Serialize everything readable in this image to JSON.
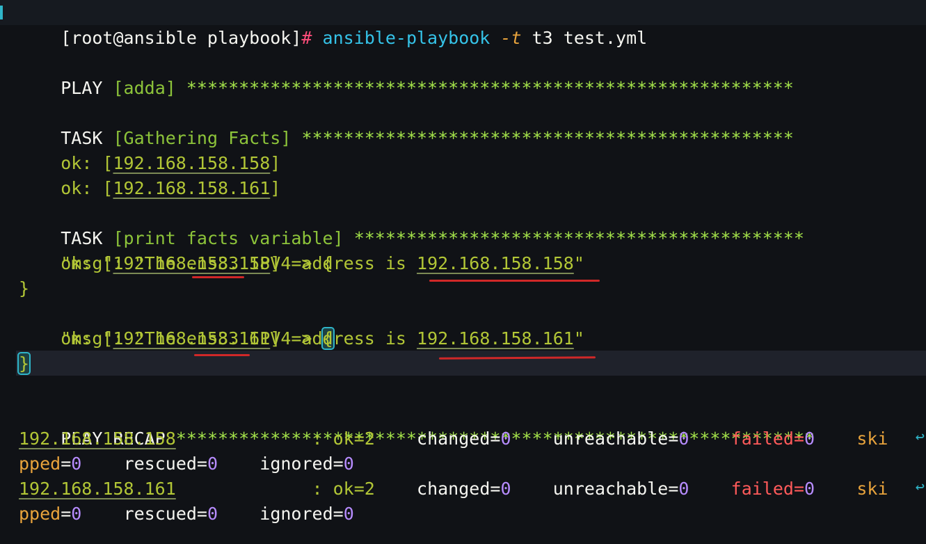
{
  "colors": {
    "background": "#101216",
    "prompt_hash": "#ff4d7a",
    "command": "#35c3e8",
    "option": "#e8a33c",
    "ok": "#b2c636",
    "stars": "#a4e34a",
    "number": "#b78cff",
    "failed": "#ff5a5a",
    "annotation": "#d02828"
  },
  "command": {
    "prompt": "[root@ansible playbook]",
    "hash": "#",
    "program": "ansible-playbook",
    "option": "-t",
    "tag": "t3",
    "file": "test.yml"
  },
  "play": {
    "label": "PLAY",
    "name": "[adda]",
    "stars": "**********************************************************"
  },
  "tasks": [
    {
      "label": "TASK",
      "name": "[Gathering Facts]",
      "stars": "***********************************************",
      "results": [
        {
          "status": "ok:",
          "host": "192.168.158.158"
        },
        {
          "status": "ok:",
          "host": "192.168.158.161"
        }
      ]
    },
    {
      "label": "TASK",
      "name": "[print facts variable]",
      "stars": "*******************************************",
      "results": [
        {
          "status": "ok:",
          "host": "192.168.158.158",
          "msg_key": "\"msg\"",
          "msg_pre": "The",
          "iface": "ens33",
          "msg_mid": "IPV4 address is",
          "address": "192.168.158.158"
        },
        {
          "status": "ok:",
          "host": "192.168.158.161",
          "msg_key": "\"msg\"",
          "msg_pre": "The",
          "iface": "ens33",
          "msg_mid": "IPV4 address is",
          "address": "192.168.158.161"
        }
      ]
    }
  ],
  "recap": {
    "label": "PLAY RECAP",
    "stars": "*************************************************************",
    "wrap_glyph": "↩",
    "hosts": [
      {
        "host": "192.168.158.158",
        "colon": ":",
        "ok_label": "ok",
        "ok": "2",
        "changed_label": "changed",
        "changed": "0",
        "unreachable_label": "unreachable",
        "unreachable": "0",
        "failed_label": "failed",
        "failed": "0",
        "skipped_head": "ski",
        "skipped_tail": "pped",
        "skipped": "0",
        "rescued_label": "rescued",
        "rescued": "0",
        "ignored_label": "ignored",
        "ignored": "0"
      },
      {
        "host": "192.168.158.161",
        "colon": ":",
        "ok_label": "ok",
        "ok": "2",
        "changed_label": "changed",
        "changed": "0",
        "unreachable_label": "unreachable",
        "unreachable": "0",
        "failed_label": "failed",
        "failed": "0",
        "skipped_head": "ski",
        "skipped_tail": "pped",
        "skipped": "0",
        "rescued_label": "rescued",
        "rescued": "0",
        "ignored_label": "ignored",
        "ignored": "0"
      }
    ]
  }
}
